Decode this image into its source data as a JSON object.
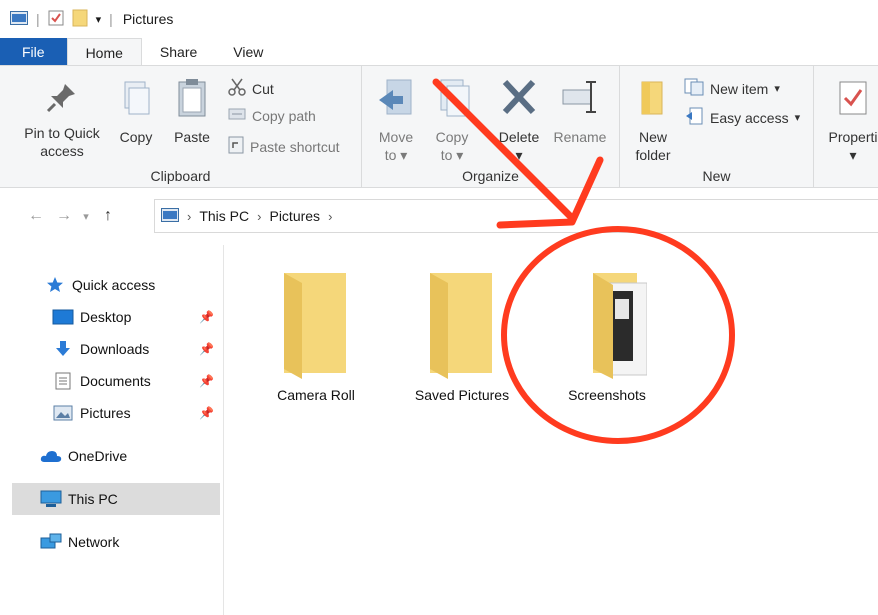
{
  "window": {
    "title": "Pictures"
  },
  "tabs": [
    {
      "label": "File"
    },
    {
      "label": "Home"
    },
    {
      "label": "Share"
    },
    {
      "label": "View"
    }
  ],
  "ribbon": {
    "clipboard": {
      "label": "Clipboard",
      "pin": "Pin to Quick access",
      "pin_line1": "Pin to Quick",
      "pin_line2": "access",
      "copy": "Copy",
      "paste": "Paste",
      "cut": "Cut",
      "copy_path": "Copy path",
      "paste_shortcut": "Paste shortcut"
    },
    "organize": {
      "label": "Organize",
      "move_to": "Move",
      "move_to_2": "to",
      "copy_to": "Copy",
      "copy_to_2": "to",
      "delete": "Delete",
      "rename": "Rename"
    },
    "new": {
      "label": "New",
      "new_folder_1": "New",
      "new_folder_2": "folder",
      "new_item": "New item",
      "easy_access": "Easy access"
    },
    "open": {
      "properties": "Properti"
    }
  },
  "address": {
    "crumbs": [
      "This PC",
      "Pictures"
    ]
  },
  "sidebar": {
    "quick_access": "Quick access",
    "items": [
      {
        "label": "Desktop"
      },
      {
        "label": "Downloads"
      },
      {
        "label": "Documents"
      },
      {
        "label": "Pictures"
      }
    ],
    "onedrive": "OneDrive",
    "this_pc": "This PC",
    "network": "Network"
  },
  "folders": [
    {
      "name": "Camera Roll"
    },
    {
      "name": "Saved Pictures"
    },
    {
      "name": "Screenshots"
    }
  ],
  "colors": {
    "file_tab": "#1a5fb4",
    "folder": "#f5d77a",
    "annotation": "#ff3b1f"
  }
}
